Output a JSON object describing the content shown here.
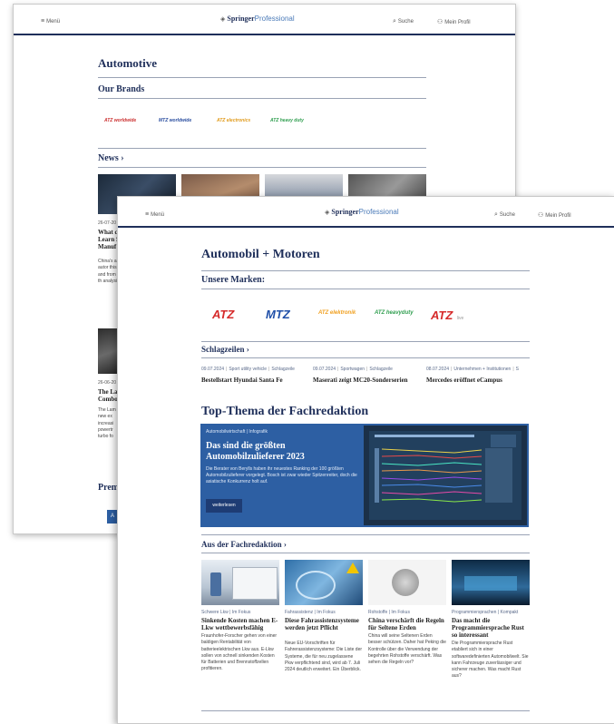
{
  "back": {
    "header": {
      "menu": "Menü",
      "logo_bold": "Springer",
      "logo_light": "Professional",
      "search": "Suche",
      "profile": "Mein Profil"
    },
    "page_title": "Automotive",
    "brands_heading": "Our Brands",
    "brands": [
      "ATZ worldwide",
      "MTZ worldwide",
      "ATZ electronics",
      "ATZ heavy duty"
    ],
    "news_heading": "News ›",
    "news1": {
      "date": "26-07-20",
      "title": "What c Learn S Manuf",
      "body": "China's an autor this and from th analysis"
    },
    "news2": {
      "date": "26-06-20",
      "title": "The La Combo",
      "body": "The Lam new ex increasi powertr turbo fo"
    },
    "premium": "Prem",
    "partial_button": "A"
  },
  "front": {
    "header": {
      "menu": "Menü",
      "logo_bold": "Springer",
      "logo_light": "Professional",
      "search": "Suche",
      "profile": "Mein Profil"
    },
    "page_title": "Automobil + Motoren",
    "brands_heading": "Unsere Marken:",
    "brands": [
      {
        "label": "ATZ",
        "color": "#d62b2b"
      },
      {
        "label": "MTZ",
        "color": "#1f4fa8"
      },
      {
        "label": "ATZ elektronik",
        "color": "#f0a020"
      },
      {
        "label": "ATZ heavyduty",
        "color": "#2f9e4f"
      },
      {
        "label": "ATZ",
        "color": "#d62b2b"
      }
    ],
    "brand_last_suffix": "live",
    "headlines_heading": "Schlagzeilen ›",
    "headlines": [
      {
        "date": "09.07.2024",
        "cat": "Sport utility vehicle",
        "type": "Schlagzeile",
        "title": "Bestellstart Hyundai Santa Fe"
      },
      {
        "date": "09.07.2024",
        "cat": "Sportwagen",
        "type": "Schlagzeile",
        "title": "Maserati zeigt MC20-Sonderserien"
      },
      {
        "date": "08.07.2024",
        "cat": "Unternehmen + Institutionen",
        "type": "S",
        "title": "Mercedes eröffnet eCampus"
      }
    ],
    "top_heading": "Top-Thema der Fachredaktion",
    "top": {
      "category": "Automobilwirtschaft | Infografik",
      "title": "Das sind die größten Automobilzulieferer 2023",
      "desc": "Die Berater von Berylls haben ihr neuestes Ranking der 100 größten Automobilzulieferer vorgelegt. Bosch ist zwar wieder Spitzenreiter, doch die asiatische Konkurrenz holt auf.",
      "button": "weiterlesen"
    },
    "editorial_heading": "Aus der Fachredaktion ›",
    "articles": [
      {
        "meta": "Schwere Lkw | Im Fokus",
        "title": "Sinkende Kosten machen E-Lkw wettbewerbsfähig",
        "body": "Fraunhofer-Forscher gehen von einer baldigen Rentabilität von batterieelektrischen Lkw aus. E-Lkw sollen von schnell sinkenden Kosten für Batterien und Brennstoffzellen profitieren."
      },
      {
        "meta": "Fahrassistenz | Im Fokus",
        "title": "Diese Fahrassistenzsysteme werden jetzt Pflicht",
        "body": "Neue EU-Vorschriften für Fahrerassistenzsysteme: Die Liste der Systeme, die für neu zugelassene Pkw verpflichtend sind, wird ab 7. Juli 2024 deutlich erweitert. Ein Überblick."
      },
      {
        "meta": "Rohstoffe | Im Fokus",
        "title": "China verschärft die Regeln für Seltene Erden",
        "body": "China will seine Seltenen Erden besser schützen. Daher hat Peking die Kontrolle über die Verwendung der begehrten Rohstoffe verschärft. Was sehen die Regeln vor?"
      },
      {
        "meta": "Programmiersprachen | Kompakt",
        "title": "Das macht die Programmiersprache Rust so interessant",
        "body": "Die Programmiersprache Rust etabliert sich in einer softwaredefinierten Automobilwelt. Sie kann Fahrzeuge zuverlässiger und sicherer machen. Was macht Rust aus?"
      }
    ]
  },
  "colors": {
    "navy": "#1f2f5a",
    "banner": "#2d5fa3"
  }
}
